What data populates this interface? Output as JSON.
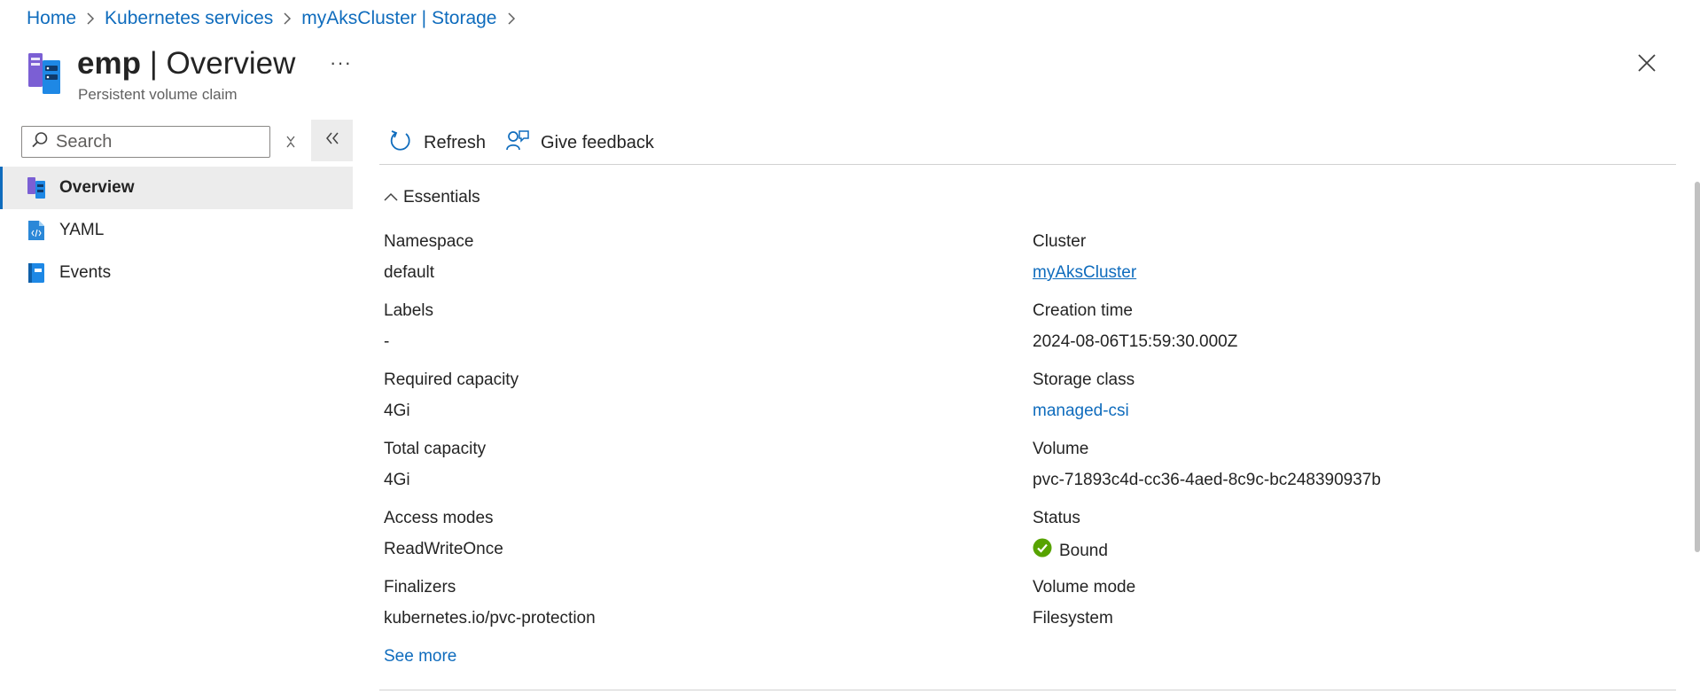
{
  "breadcrumb": {
    "items": [
      "Home",
      "Kubernetes services",
      "myAksCluster | Storage"
    ]
  },
  "header": {
    "title_name": "emp",
    "title_rest": " | Overview",
    "subtitle": "Persistent volume claim",
    "more_label": "···"
  },
  "search": {
    "placeholder": "Search"
  },
  "nav": {
    "items": [
      {
        "label": "Overview",
        "icon": "pvc-icon"
      },
      {
        "label": "YAML",
        "icon": "yaml-file-icon"
      },
      {
        "label": "Events",
        "icon": "events-icon"
      }
    ]
  },
  "toolbar": {
    "refresh_label": "Refresh",
    "feedback_label": "Give feedback"
  },
  "essentials": {
    "toggle_label": "Essentials",
    "left": [
      {
        "label": "Namespace",
        "value": "default"
      },
      {
        "label": "Labels",
        "value": "-"
      },
      {
        "label": "Required capacity",
        "value": "4Gi"
      },
      {
        "label": "Total capacity",
        "value": "4Gi"
      },
      {
        "label": "Access modes",
        "value": "ReadWriteOnce"
      },
      {
        "label": "Finalizers",
        "value": "kubernetes.io/pvc-protection"
      }
    ],
    "right": [
      {
        "label": "Cluster",
        "value": "myAksCluster"
      },
      {
        "label": "Creation time",
        "value": "2024-08-06T15:59:30.000Z"
      },
      {
        "label": "Storage class",
        "value": "managed-csi"
      },
      {
        "label": "Volume",
        "value": "pvc-71893c4d-cc36-4aed-8c9c-bc248390937b"
      },
      {
        "label": "Status",
        "value": "Bound"
      },
      {
        "label": "Volume mode",
        "value": "Filesystem"
      }
    ],
    "see_more_label": "See more"
  },
  "colors": {
    "link": "#0f6cbd",
    "status_success": "#57a300",
    "nav_active_bg": "#ececec"
  }
}
